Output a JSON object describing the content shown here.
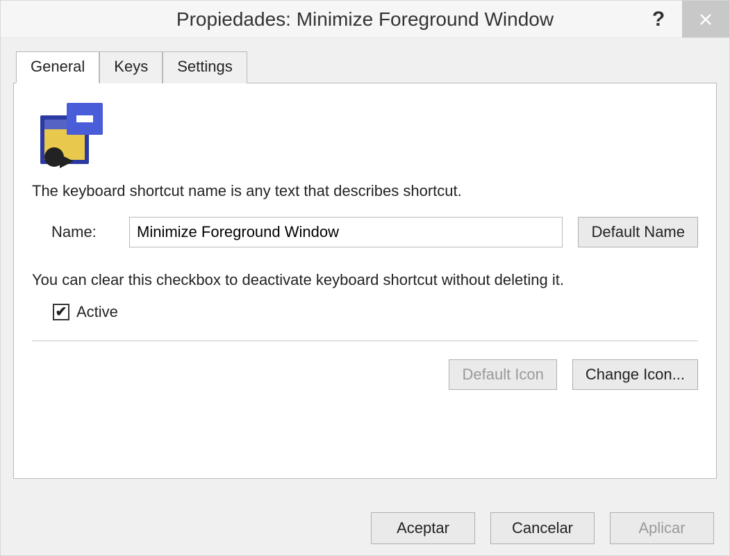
{
  "window": {
    "title": "Propiedades: Minimize Foreground Window"
  },
  "tabs": [
    {
      "label": "General",
      "active": true
    },
    {
      "label": "Keys",
      "active": false
    },
    {
      "label": "Settings",
      "active": false
    }
  ],
  "general": {
    "description": "The keyboard shortcut name is any text that describes shortcut.",
    "name_label": "Name:",
    "name_value": "Minimize Foreground Window",
    "default_name_button": "Default Name",
    "deactivate_note": "You can clear this checkbox to deactivate keyboard shortcut without deleting it.",
    "active_checkbox": {
      "label": "Active",
      "checked": true
    },
    "default_icon_button": "Default Icon",
    "change_icon_button": "Change Icon..."
  },
  "footer": {
    "accept": "Aceptar",
    "cancel": "Cancelar",
    "apply": "Aplicar"
  }
}
